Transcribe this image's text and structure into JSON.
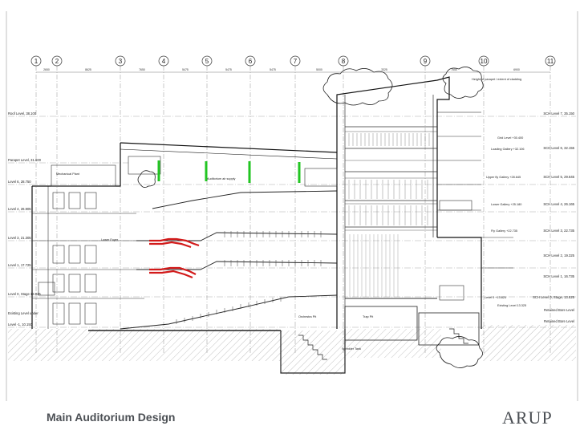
{
  "slide": {
    "caption": "Main Auditorium Design",
    "logo": "ARUP"
  },
  "drawing": {
    "grid_labels": [
      "1",
      "2",
      "3",
      "4",
      "5",
      "6",
      "7",
      "8",
      "9",
      "10",
      "11"
    ],
    "grid_spacings": [
      "2650",
      "8625",
      "7650",
      "5475",
      "5475",
      "5475",
      "5000",
      "3325",
      "7550",
      "6900"
    ],
    "level_labels_left": [
      "Roof Level, 38.100",
      "Parapet Level, 31.600",
      "Level 6, 28.750",
      "Level 4, 26.905",
      "Level 3, 21.305",
      "Level 1, 17.725",
      "Level 0, Stage 13.825",
      "Existing Level under",
      "Level -1, 10.150"
    ],
    "level_labels_right": [
      "SCH Level 7, 35.150",
      "SCH Level 6, 32.155",
      "SCH Level 5, 29.645",
      "SCH Level 4, 26.165",
      "SCH Level 3, 22.735",
      "SCH Level 2, 19.325",
      "SCH Level 1, 16.735",
      "SCH Level 0, Stage, 13.825",
      "Retained Bore Level",
      "Retained Bore Level"
    ],
    "annotations": [
      "Height of parapet / extent of cladding",
      "Grid Level +30.400",
      "Loading Gallery +32.106",
      "Upper fly Gallery +28.645",
      "Lower Gallery +25.180",
      "Fly Gallery +22.735",
      "Level 0 +13.825",
      "Existing Level 13.325",
      "Mechanical Plant",
      "Auditorium air supply",
      "Lower Foyer",
      "Orchestra Pit",
      "Trap Pit",
      "Sprinkler Tank"
    ]
  }
}
